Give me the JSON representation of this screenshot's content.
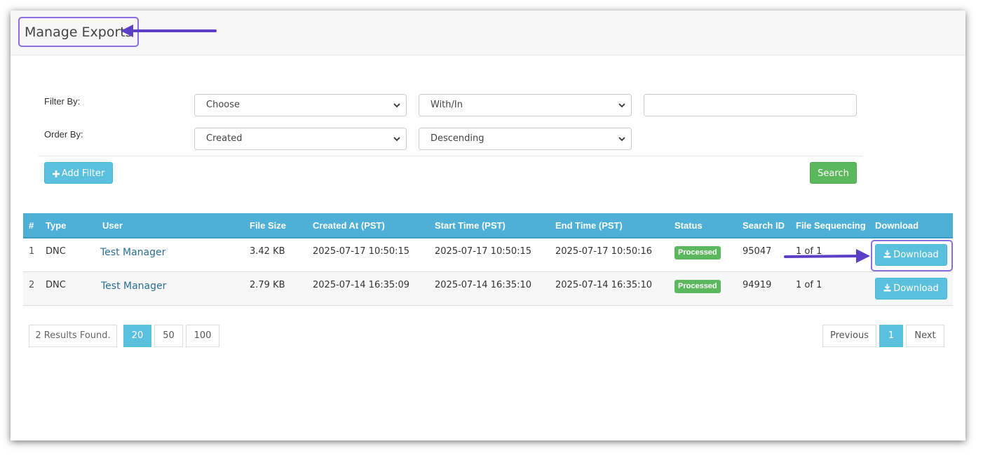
{
  "header": {
    "title": "Manage Exports"
  },
  "filters": {
    "filter_by_label": "Filter By:",
    "order_by_label": "Order By:",
    "filter_field": "Choose",
    "filter_operator": "With/In",
    "filter_value": "",
    "order_field": "Created",
    "order_direction": "Descending",
    "add_filter_label": "Add Filter",
    "search_label": "Search"
  },
  "table": {
    "columns": [
      "#",
      "Type",
      "User",
      "File Size",
      "Created At (PST)",
      "Start Time (PST)",
      "End Time (PST)",
      "Status",
      "Search ID",
      "File Sequencing",
      "Download"
    ],
    "rows": [
      {
        "idx": "1",
        "type": "DNC",
        "user": "Test Manager",
        "file_size": "3.42 KB",
        "created_at": "2025-07-17 10:50:15",
        "start_time": "2025-07-17 10:50:15",
        "end_time": "2025-07-17 10:50:16",
        "status": "Processed",
        "search_id": "95047",
        "file_sequencing": "1 of 1",
        "download": "Download"
      },
      {
        "idx": "2",
        "type": "DNC",
        "user": "Test Manager",
        "file_size": "2.79 KB",
        "created_at": "2025-07-14 16:35:09",
        "start_time": "2025-07-14 16:35:10",
        "end_time": "2025-07-14 16:35:10",
        "status": "Processed",
        "search_id": "94919",
        "file_sequencing": "1 of 1",
        "download": "Download"
      }
    ]
  },
  "pagination": {
    "results_found": "2 Results Found.",
    "page_sizes": [
      "20",
      "50",
      "100"
    ],
    "active_page_size": "20",
    "previous_label": "Previous",
    "current_page": "1",
    "next_label": "Next"
  },
  "colors": {
    "accent": "#5bc0de",
    "header_bar": "#4eb0d6",
    "success": "#5cb85c",
    "annotation": "#5b3fc4"
  }
}
